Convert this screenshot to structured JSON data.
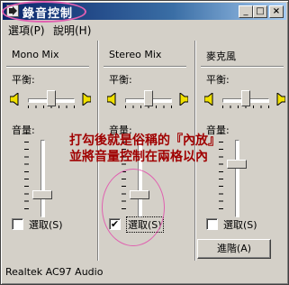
{
  "window": {
    "title": "錄音控制",
    "buttons": {
      "minimize": "_",
      "maximize": "□",
      "close": "×"
    }
  },
  "menu": [
    {
      "label": "選項(P)"
    },
    {
      "label": "說明(H)"
    }
  ],
  "columns": [
    {
      "name": "Mono Mix",
      "balance_label": "平衡:",
      "volume_label": "音量:",
      "select_label": "選取(S)",
      "selected": false,
      "volume_level": 0.2
    },
    {
      "name": "Stereo Mix",
      "balance_label": "平衡:",
      "volume_label": "音量:",
      "select_label": "選取(S)",
      "selected": true,
      "volume_level": 0.2
    },
    {
      "name": "麥克風",
      "balance_label": "平衡:",
      "volume_label": "音量:",
      "select_label": "選取(S)",
      "selected": false,
      "volume_level": 0.7
    }
  ],
  "advanced_button": "進階(A)",
  "status": "Realtek AC97 Audio",
  "annotation": {
    "line1": "打勾後就是俗稱的『內放』",
    "line2": "並將音量控制在兩格以內"
  },
  "colors": {
    "title_start": "#0a246a",
    "annotation_text": "#a00000",
    "highlight_ring": "#e060b0"
  }
}
